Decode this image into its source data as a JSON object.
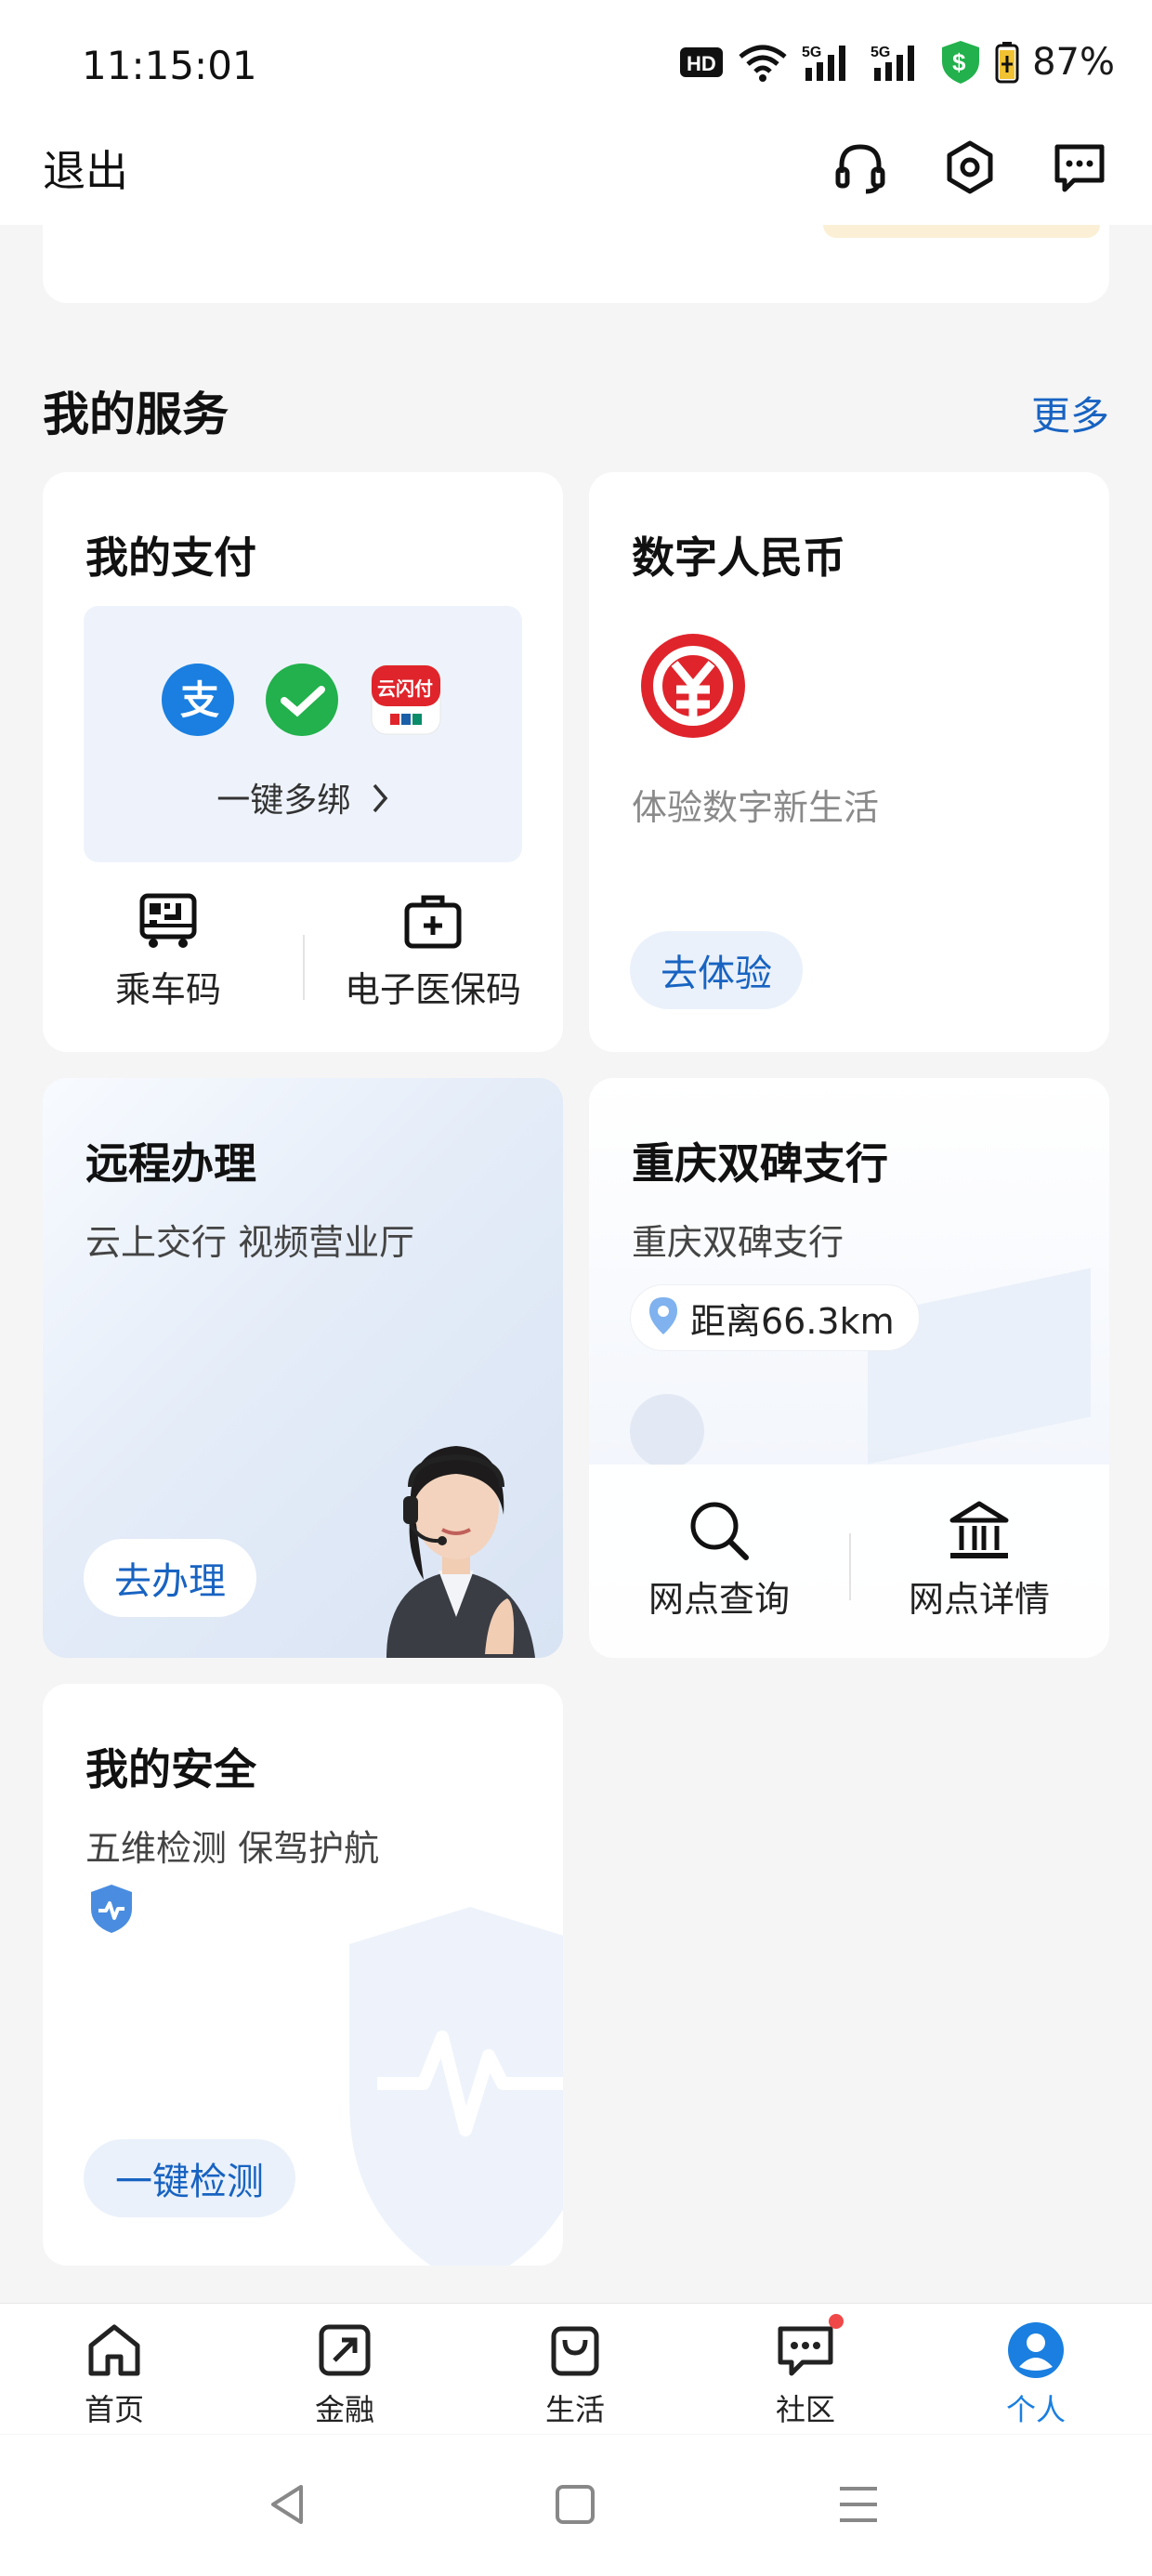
{
  "status_bar": {
    "time": "11:15:01",
    "battery": "87%",
    "network_1": "5G",
    "network_2": "5G",
    "hd_label": "HD"
  },
  "header": {
    "exit_label": "退出"
  },
  "section": {
    "title": "我的服务",
    "more_label": "更多"
  },
  "payment_card": {
    "title": "我的支付",
    "bind_label": "一键多绑",
    "unionpay_text": "云闪付",
    "actions": [
      {
        "label": "乘车码"
      },
      {
        "label": "电子医保码"
      }
    ]
  },
  "ecny_card": {
    "title": "数字人民币",
    "subtitle": "体验数字新生活",
    "button": "去体验"
  },
  "remote_card": {
    "title": "远程办理",
    "subtitle": "云上交行 视频营业厅",
    "button": "去办理"
  },
  "branch_card": {
    "title": "重庆双碑支行",
    "subtitle": "重庆双碑支行",
    "distance": "距离66.3km",
    "actions": [
      {
        "label": "网点查询"
      },
      {
        "label": "网点详情"
      }
    ]
  },
  "security_card": {
    "title": "我的安全",
    "subtitle": "五维检测 保驾护航",
    "button": "一键检测"
  },
  "tabbar": {
    "items": [
      {
        "label": "首页",
        "icon": "home-icon"
      },
      {
        "label": "金融",
        "icon": "finance-icon"
      },
      {
        "label": "生活",
        "icon": "shopping-bag-icon"
      },
      {
        "label": "社区",
        "icon": "chat-icon"
      },
      {
        "label": "个人",
        "icon": "person-icon"
      }
    ],
    "active_index": 4,
    "active_color": "#1a7fe0"
  },
  "colors": {
    "accent": "#1863c1",
    "ecny_red": "#e0242b",
    "badge_red": "#f04848"
  }
}
